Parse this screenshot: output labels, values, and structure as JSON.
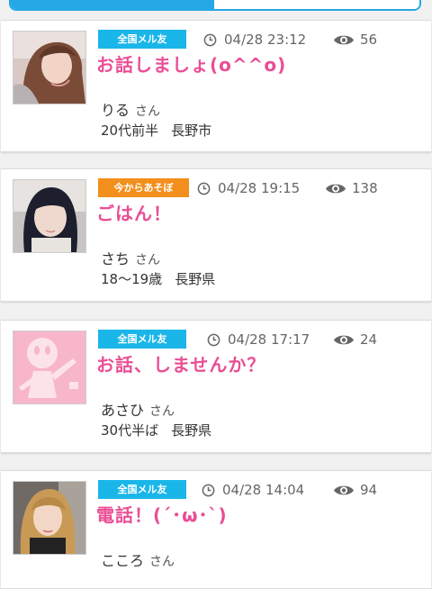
{
  "posts": [
    {
      "badge": "全国メル友",
      "time": "04/28 23:12",
      "views": "56",
      "title": "お話しましょ(o^^o)",
      "name": "りる",
      "honorific": "さん",
      "age": "20代前半",
      "location": "長野市"
    },
    {
      "badge": "今からあそぼ",
      "time": "04/28 19:15",
      "views": "138",
      "title": "ごはん！",
      "name": "さち",
      "honorific": "さん",
      "age": "18〜19歳",
      "location": "長野県"
    },
    {
      "badge": "全国メル友",
      "time": "04/28 17:17",
      "views": "24",
      "title": "お話、しませんか？",
      "name": "あさひ",
      "honorific": "さん",
      "age": "30代半ば",
      "location": "長野県"
    },
    {
      "badge": "全国メル友",
      "time": "04/28 14:04",
      "views": "94",
      "title": "電話！(´･ω･`)",
      "name": "こころ",
      "honorific": "さん",
      "age": "",
      "location": ""
    }
  ],
  "colors": {
    "accent": "#25a8e6",
    "badge_blue": "#1ab6e9",
    "badge_orange": "#f28f1d",
    "title_pink": "#ea4e95"
  },
  "icons": {
    "time": "clock-icon",
    "views": "eye-icon"
  }
}
